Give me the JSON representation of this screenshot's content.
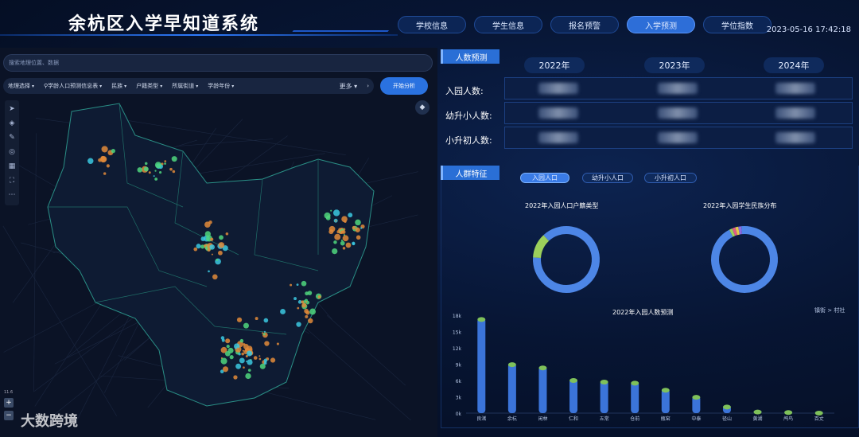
{
  "header": {
    "title": "余杭区入学早知道系统",
    "datetime": "2023-05-16 17:42:18",
    "nav": [
      {
        "label": "学校信息",
        "active": false
      },
      {
        "label": "学生信息",
        "active": false
      },
      {
        "label": "报名预警",
        "active": false
      },
      {
        "label": "入学预测",
        "active": true
      },
      {
        "label": "学位指数",
        "active": false
      }
    ]
  },
  "map": {
    "search_placeholder": "搜索地理位置、数据",
    "filters": [
      "地理选择",
      "学龄人口预测信息表",
      "民族",
      "户籍类型",
      "所属街道",
      "学龄年份"
    ],
    "more_label": "更多",
    "start_label": "开始分析",
    "zoom_level": "11.6",
    "watermark": "大数跨境"
  },
  "prediction": {
    "tag": "人数预测",
    "years": [
      "2022年",
      "2023年",
      "2024年"
    ],
    "rows": [
      "入园人数:",
      "幼升小人数:",
      "小升初人数:"
    ]
  },
  "features": {
    "tag": "人群特征",
    "chips": [
      {
        "label": "入园人口",
        "active": true
      },
      {
        "label": "幼升小人口",
        "active": false
      },
      {
        "label": "小升初人口",
        "active": false
      }
    ],
    "donut1_title": "2022年入园人口户籍类型",
    "donut2_title": "2022年入园学生民族分布",
    "bar_title": "2022年入园人数预测",
    "breadcrumb": "镇街 > 村社"
  },
  "colors": {
    "accent": "#2a6fd6",
    "bar_top": "#7fc15a",
    "bar_body": "#3b74d9",
    "donut_main": "#4d86e6",
    "donut_second": "#9cd05b"
  },
  "chart_data": [
    {
      "type": "pie",
      "title": "2022年入园人口户籍类型",
      "values": [
        0.88,
        0.12
      ]
    },
    {
      "type": "pie",
      "title": "2022年入园学生民族分布",
      "values": [
        0.94,
        0.015,
        0.015,
        0.015,
        0.015
      ]
    },
    {
      "type": "bar",
      "title": "2022年入园人数预测",
      "categories": [
        "良渚",
        "余杭",
        "闲林",
        "仁和",
        "五常",
        "仓前",
        "瓶窑",
        "中泰",
        "径山",
        "黄湖",
        "鸬鸟",
        "百丈"
      ],
      "values": [
        17500,
        9200,
        8600,
        6300,
        6000,
        5800,
        4500,
        3200,
        1400,
        500,
        400,
        300
      ],
      "yticks": [
        "0k",
        "3k",
        "6k",
        "9k",
        "12k",
        "15k",
        "18k"
      ],
      "ylim": [
        0,
        18000
      ]
    }
  ]
}
